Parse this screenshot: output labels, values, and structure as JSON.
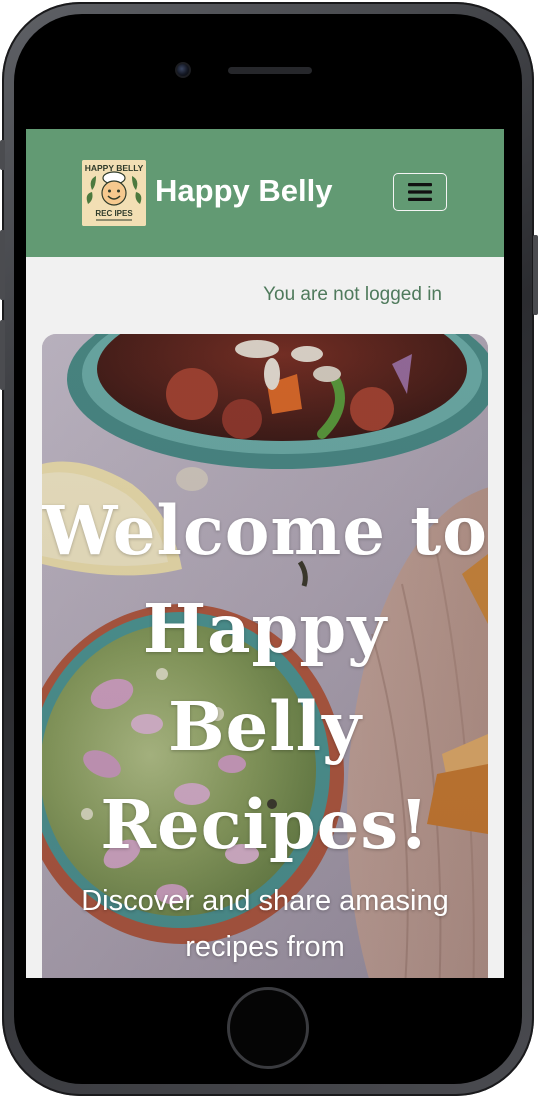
{
  "navbar": {
    "brand": "Happy Belly",
    "logo": {
      "top_text": "HAPPY BELLY",
      "bottom_text": "REC IPES",
      "icon": "smiling-chef-logo"
    },
    "toggler_icon": "hamburger-menu-icon",
    "background_color": "#629a73"
  },
  "status": {
    "login_text": "You are not logged in",
    "color": "#4f7a5c"
  },
  "hero": {
    "title": "Welcome to Happy Belly Recipes!",
    "subtitle": "Discover and share amasing recipes from",
    "background": "food-photo-guacamole-and-stew"
  }
}
